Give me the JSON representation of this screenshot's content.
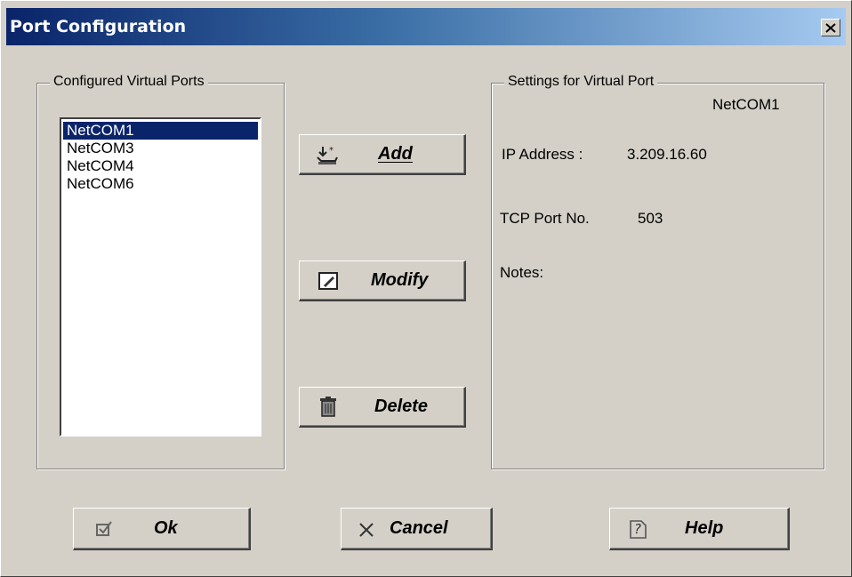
{
  "window": {
    "title": "Port Configuration"
  },
  "configured": {
    "label": "Configured Virtual Ports",
    "items": [
      {
        "label": "NetCOM1",
        "selected": true
      },
      {
        "label": "NetCOM3",
        "selected": false
      },
      {
        "label": "NetCOM4",
        "selected": false
      },
      {
        "label": "NetCOM6",
        "selected": false
      }
    ]
  },
  "actions": {
    "add_label": "Add",
    "modify_label": "Modify",
    "delete_label": "Delete"
  },
  "settings": {
    "label": "Settings for Virtual Port",
    "port_name": "NetCOM1",
    "ip_label": "IP Address :",
    "ip_value": "3.209.16.60",
    "tcp_label": "TCP Port No.",
    "tcp_value": "503",
    "notes_label": "Notes:"
  },
  "footer": {
    "ok_label": "Ok",
    "cancel_label": "Cancel",
    "help_label": "Help"
  },
  "icons": {
    "close": "close-icon",
    "add": "add-port-icon",
    "modify": "edit-icon",
    "delete": "trash-icon",
    "ok": "checkbox-check-icon",
    "cancel": "x-icon",
    "help": "help-document-icon"
  }
}
